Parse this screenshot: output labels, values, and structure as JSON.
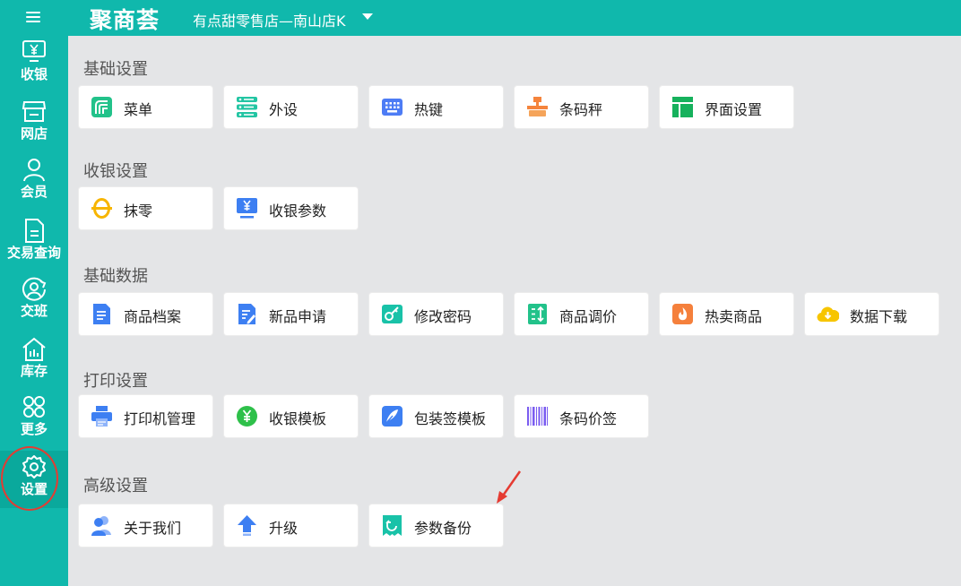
{
  "app": {
    "logo": "聚商荟",
    "store": "有点甜零售店—南山店K"
  },
  "sidebar": {
    "items": [
      {
        "label": "收银",
        "icon": "cashier-icon"
      },
      {
        "label": "网店",
        "icon": "shop-icon"
      },
      {
        "label": "会员",
        "icon": "user-icon"
      },
      {
        "label": "交易查询",
        "icon": "document-icon"
      },
      {
        "label": "交班",
        "icon": "shift-icon"
      },
      {
        "label": "库存",
        "icon": "warehouse-icon"
      },
      {
        "label": "更多",
        "icon": "more-icon"
      },
      {
        "label": "设置",
        "icon": "gear-icon",
        "active": true
      }
    ]
  },
  "sections": [
    {
      "title": "基础设置",
      "tiles": [
        "菜单",
        "外设",
        "热键",
        "条码秤",
        "界面设置"
      ]
    },
    {
      "title": "收银设置",
      "tiles": [
        "抹零",
        "收银参数"
      ]
    },
    {
      "title": "基础数据",
      "tiles": [
        "商品档案",
        "新品申请",
        "修改密码",
        "商品调价",
        "热卖商品",
        "数据下载"
      ]
    },
    {
      "title": "打印设置",
      "tiles": [
        "打印机管理",
        "收银模板",
        "包装签模板",
        "条码价签"
      ]
    },
    {
      "title": "高级设置",
      "tiles": [
        "关于我们",
        "升级",
        "参数备份"
      ]
    }
  ],
  "colors": {
    "brand": "#10b8ac",
    "highlight": "#e53b32"
  }
}
